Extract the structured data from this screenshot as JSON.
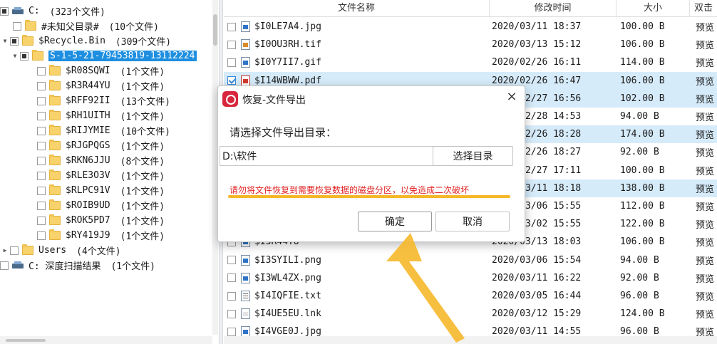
{
  "tree": {
    "nodes": [
      {
        "name": "C:",
        "count": "(323个文件)",
        "toggle": "",
        "checkbox": "partial",
        "icon": "drive",
        "selected": false
      },
      {
        "name": "#未知父目录#",
        "count": "(10个文件)",
        "toggle": "",
        "checkbox": "empty",
        "icon": "folder",
        "selected": false
      },
      {
        "name": "$Recycle.Bin",
        "count": "(309个文件)",
        "toggle": "▼",
        "checkbox": "partial",
        "icon": "folder",
        "selected": false
      },
      {
        "name": "S-1-5-21-79453819-13112224",
        "count": "",
        "toggle": "▼",
        "checkbox": "partial",
        "icon": "folder",
        "selected": true
      },
      {
        "name": "$R08SQWI",
        "count": "(1个文件)",
        "toggle": "",
        "checkbox": "empty",
        "icon": "folder",
        "selected": false
      },
      {
        "name": "$R3R44YU",
        "count": "(1个文件)",
        "toggle": "",
        "checkbox": "empty",
        "icon": "folder",
        "selected": false
      },
      {
        "name": "$RFF92II",
        "count": "(13个文件)",
        "toggle": "",
        "checkbox": "empty",
        "icon": "folder",
        "selected": false
      },
      {
        "name": "$RH1UITH",
        "count": "(1个文件)",
        "toggle": "",
        "checkbox": "empty",
        "icon": "folder",
        "selected": false
      },
      {
        "name": "$RIJYMIE",
        "count": "(10个文件)",
        "toggle": "",
        "checkbox": "empty",
        "icon": "folder",
        "selected": false
      },
      {
        "name": "$RJGPQGS",
        "count": "(1个文件)",
        "toggle": "",
        "checkbox": "empty",
        "icon": "folder",
        "selected": false
      },
      {
        "name": "$RKN6JJU",
        "count": "(8个文件)",
        "toggle": "",
        "checkbox": "empty",
        "icon": "folder",
        "selected": false
      },
      {
        "name": "$RLE3O3V",
        "count": "(1个文件)",
        "toggle": "",
        "checkbox": "empty",
        "icon": "folder",
        "selected": false
      },
      {
        "name": "$RLPC91V",
        "count": "(1个文件)",
        "toggle": "",
        "checkbox": "empty",
        "icon": "folder",
        "selected": false
      },
      {
        "name": "$ROIB9UD",
        "count": "(1个文件)",
        "toggle": "",
        "checkbox": "empty",
        "icon": "folder",
        "selected": false
      },
      {
        "name": "$ROK5PD7",
        "count": "(1个文件)",
        "toggle": "",
        "checkbox": "empty",
        "icon": "folder",
        "selected": false
      },
      {
        "name": "$RY419J9",
        "count": "(1个文件)",
        "toggle": "",
        "checkbox": "empty",
        "icon": "folder",
        "selected": false
      },
      {
        "name": "Users",
        "count": "(4个文件)",
        "toggle": "▶",
        "checkbox": "empty",
        "icon": "folder",
        "selected": false
      },
      {
        "name": "C: 深度扫描结果",
        "count": "(1个文件)",
        "toggle": "",
        "checkbox": "empty",
        "icon": "drive",
        "selected": false
      }
    ]
  },
  "list": {
    "headers": {
      "name": "文件名称",
      "date": "修改时间",
      "size": "大小",
      "action": "双击"
    },
    "rows": [
      {
        "name": "$I0LE7A4.jpg",
        "date": "2020/03/11 18:37",
        "size": "100.00 B",
        "preview": "预览",
        "type": "img",
        "checked": false,
        "selected": false
      },
      {
        "name": "$I0OU3RH.tif",
        "date": "2020/03/13 15:12",
        "size": "106.00 B",
        "preview": "预览",
        "type": "tif",
        "checked": false,
        "selected": false
      },
      {
        "name": "$I0Y7II7.gif",
        "date": "2020/02/26 16:11",
        "size": "114.00 B",
        "preview": "预览",
        "type": "img",
        "checked": false,
        "selected": false
      },
      {
        "name": "$I14WBWW.pdf",
        "date": "2020/02/26 16:47",
        "size": "106.00 B",
        "preview": "预览",
        "type": "pdf",
        "checked": true,
        "selected": true
      },
      {
        "name": "",
        "date": "2020/02/27 16:56",
        "size": "102.00 B",
        "preview": "预览",
        "type": "img",
        "checked": false,
        "selected": true
      },
      {
        "name": "",
        "date": "2020/02/28 14:53",
        "size": "94.00 B",
        "preview": "预览",
        "type": "img",
        "checked": false,
        "selected": false
      },
      {
        "name": "",
        "date": "2020/02/26 18:28",
        "size": "174.00 B",
        "preview": "预览",
        "type": "img",
        "checked": false,
        "selected": true
      },
      {
        "name": "",
        "date": "2020/02/26 18:27",
        "size": "92.00 B",
        "preview": "预览",
        "type": "img",
        "checked": false,
        "selected": false
      },
      {
        "name": "",
        "date": "2020/02/27 17:11",
        "size": "100.00 B",
        "preview": "预览",
        "type": "img",
        "checked": false,
        "selected": false
      },
      {
        "name": "",
        "date": "2020/03/11 18:18",
        "size": "138.00 B",
        "preview": "预览",
        "type": "img",
        "checked": false,
        "selected": true
      },
      {
        "name": "",
        "date": "2020/03/06 15:55",
        "size": "112.00 B",
        "preview": "预览",
        "type": "img",
        "checked": false,
        "selected": false
      },
      {
        "name": "",
        "date": "2020/03/02 15:55",
        "size": "122.00 B",
        "preview": "预览",
        "type": "img",
        "checked": false,
        "selected": false
      },
      {
        "name": "$I3R44YU",
        "date": "2020/03/13 18:03",
        "size": "106.00 B",
        "preview": "预览",
        "type": "img",
        "checked": false,
        "selected": false
      },
      {
        "name": "$I3SYILI.png",
        "date": "2020/03/06 15:54",
        "size": "94.00 B",
        "preview": "预览",
        "type": "img",
        "checked": false,
        "selected": false
      },
      {
        "name": "$I3WL4ZX.png",
        "date": "2020/03/11 16:22",
        "size": "92.00 B",
        "preview": "预览",
        "type": "img",
        "checked": false,
        "selected": false
      },
      {
        "name": "$I4IQFIE.txt",
        "date": "2020/03/05 16:44",
        "size": "96.00 B",
        "preview": "预览",
        "type": "txt",
        "checked": false,
        "selected": false
      },
      {
        "name": "$I4UE5EU.lnk",
        "date": "2020/03/12 15:29",
        "size": "124.00 B",
        "preview": "预览",
        "type": "lnk",
        "checked": false,
        "selected": false
      },
      {
        "name": "$I4VGE0J.jpg",
        "date": "2020/03/11 14:55",
        "size": "96.00 B",
        "preview": "预览",
        "type": "img",
        "checked": false,
        "selected": false
      }
    ]
  },
  "dialog": {
    "title": "恢复-文件导出",
    "close_label": "×",
    "prompt": "请选择文件导出目录：",
    "path_value": "D:\\软件",
    "browse_label": "选择目录",
    "warning": "请勿将文件恢复到需要恢复数据的磁盘分区，以免造成二次破坏",
    "ok_label": "确定",
    "cancel_label": "取消"
  },
  "colors": {
    "selection": "#1e8fe0",
    "row_selected": "#d6ebfa",
    "warning": "#e02424",
    "highlight": "#f6b82a",
    "logo": "#d7263d"
  },
  "icons": {
    "drive": "drive-icon",
    "folder": "folder-icon",
    "image_file": "image-file-icon",
    "pdf_file": "pdf-file-icon",
    "text_file": "text-file-icon",
    "shortcut_file": "shortcut-file-icon",
    "dialog_logo": "app-logo-icon",
    "close": "close-icon",
    "callout": "arrow-callout-icon"
  }
}
